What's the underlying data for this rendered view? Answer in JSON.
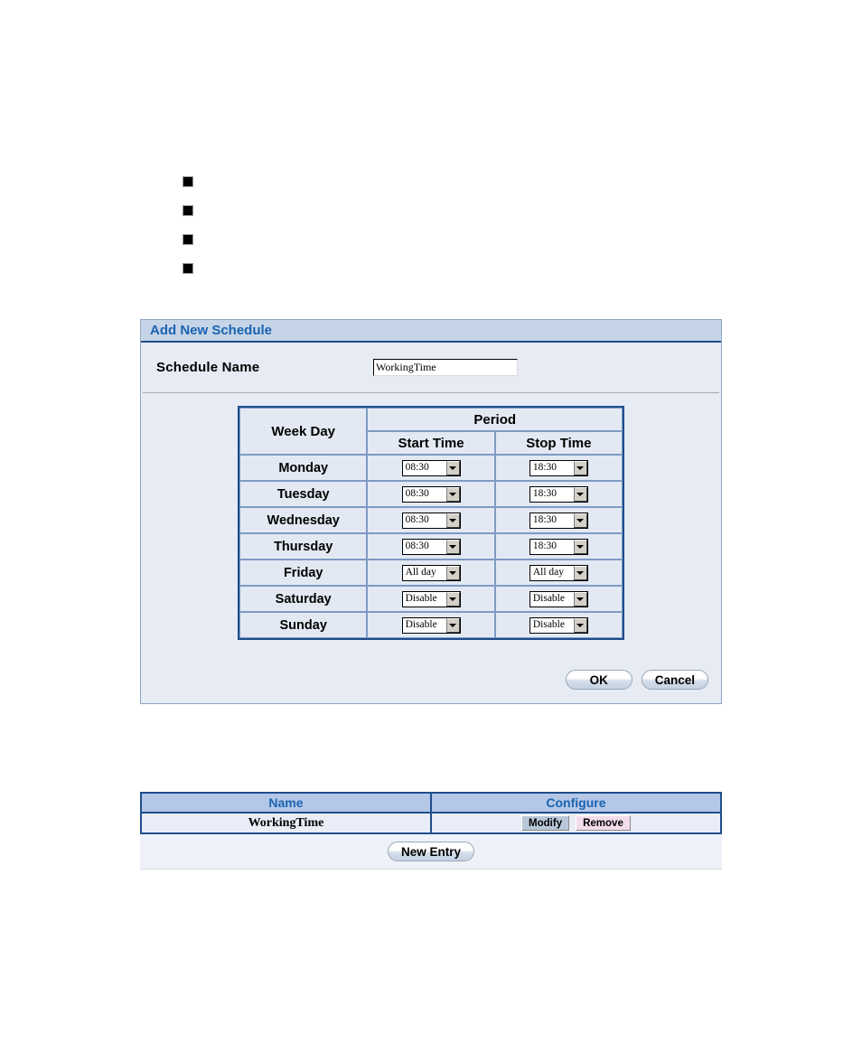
{
  "bullets": [
    {
      "text": ""
    },
    {
      "text": ""
    },
    {
      "text": ""
    },
    {
      "text": ""
    }
  ],
  "panel": {
    "title": "Add New Schedule",
    "name_label": "Schedule Name",
    "name_value": "WorkingTime",
    "name_placeholder": "",
    "table": {
      "header_weekday": "Week Day",
      "header_period": "Period",
      "header_start": "Start Time",
      "header_stop": "Stop Time",
      "rows": [
        {
          "day": "Monday",
          "start": "08:30",
          "stop": "18:30"
        },
        {
          "day": "Tuesday",
          "start": "08:30",
          "stop": "18:30"
        },
        {
          "day": "Wednesday",
          "start": "08:30",
          "stop": "18:30"
        },
        {
          "day": "Thursday",
          "start": "08:30",
          "stop": "18:30"
        },
        {
          "day": "Friday",
          "start": "All day",
          "stop": "All day"
        },
        {
          "day": "Saturday",
          "start": "Disable",
          "stop": "Disable"
        },
        {
          "day": "Sunday",
          "start": "Disable",
          "stop": "Disable"
        }
      ]
    },
    "ok_label": "OK",
    "cancel_label": "Cancel"
  },
  "list": {
    "header_name": "Name",
    "header_configure": "Configure",
    "rows": [
      {
        "name": "WorkingTime",
        "modify_label": "Modify",
        "remove_label": "Remove"
      }
    ],
    "new_entry_label": "New Entry"
  },
  "colors": {
    "title_text": "#1a63b0",
    "title_bar": "#c6d4e8",
    "panel_bg": "#e6ebf4",
    "table_border": "#1f4e8c",
    "cell_border": "#7e9ac4",
    "cell_bg": "#e2e9f3",
    "list_header_bg": "#b4c7e7",
    "modify_btn": "#b8c6d9",
    "remove_btn": "#f2dcec"
  }
}
